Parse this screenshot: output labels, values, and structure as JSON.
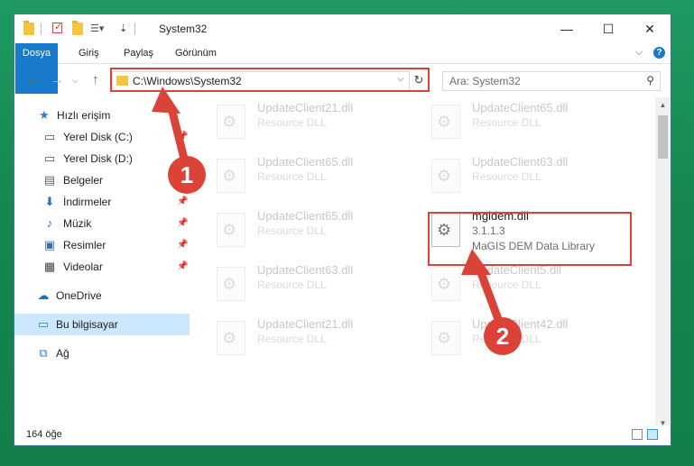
{
  "window": {
    "title": "System32",
    "minimize": "—",
    "maximize": "☐",
    "close": "✕"
  },
  "ribbon": {
    "tabs": [
      "Dosya",
      "Giriş",
      "Paylaş",
      "Görünüm"
    ],
    "expand": "⌵",
    "help": "?"
  },
  "address": {
    "path": "C:\\Windows\\System32",
    "search_placeholder": "Ara: System32"
  },
  "sidebar": {
    "items": [
      {
        "label": "Hızlı erişim",
        "icon": "star-icon"
      },
      {
        "label": "Yerel Disk (C:)",
        "icon": "drive-icon"
      },
      {
        "label": "Yerel Disk (D:)",
        "icon": "drive-icon"
      },
      {
        "label": "Belgeler",
        "icon": "documents-icon"
      },
      {
        "label": "İndirmeler",
        "icon": "download-icon"
      },
      {
        "label": "Müzik",
        "icon": "music-icon"
      },
      {
        "label": "Resimler",
        "icon": "pictures-icon"
      },
      {
        "label": "Videolar",
        "icon": "video-icon"
      },
      {
        "label": "OneDrive",
        "icon": "cloud-icon"
      },
      {
        "label": "Bu bilgisayar",
        "icon": "computer-icon"
      },
      {
        "label": "Ağ",
        "icon": "network-icon"
      }
    ]
  },
  "files": [
    {
      "name": "UpdateClient21.dll",
      "desc": "Resource DLL"
    },
    {
      "name": "UpdateClient65.dll",
      "desc": "Resource DLL"
    },
    {
      "name": "UpdateClient65.dll",
      "desc": "Resource DLL"
    },
    {
      "name": "UpdateClient63.dll",
      "desc": "Resource DLL"
    },
    {
      "name": "UpdateClient65.dll",
      "desc": "Resource DLL"
    },
    {
      "name": "mgidem.dll",
      "version": "3.1.1.3",
      "desc": "MaGIS DEM Data Library"
    },
    {
      "name": "UpdateClient63.dll",
      "desc": "Resource DLL"
    },
    {
      "name": "UpdateClient5.dll",
      "desc": "Resource DLL"
    },
    {
      "name": "UpdateClient21.dll",
      "desc": "Resource DLL"
    },
    {
      "name": "UpdateClient42.dll",
      "desc": "Resource DLL"
    }
  ],
  "status": {
    "count": "164 öğe"
  },
  "annotations": {
    "step1": "1",
    "step2": "2",
    "color": "#dc4338"
  }
}
